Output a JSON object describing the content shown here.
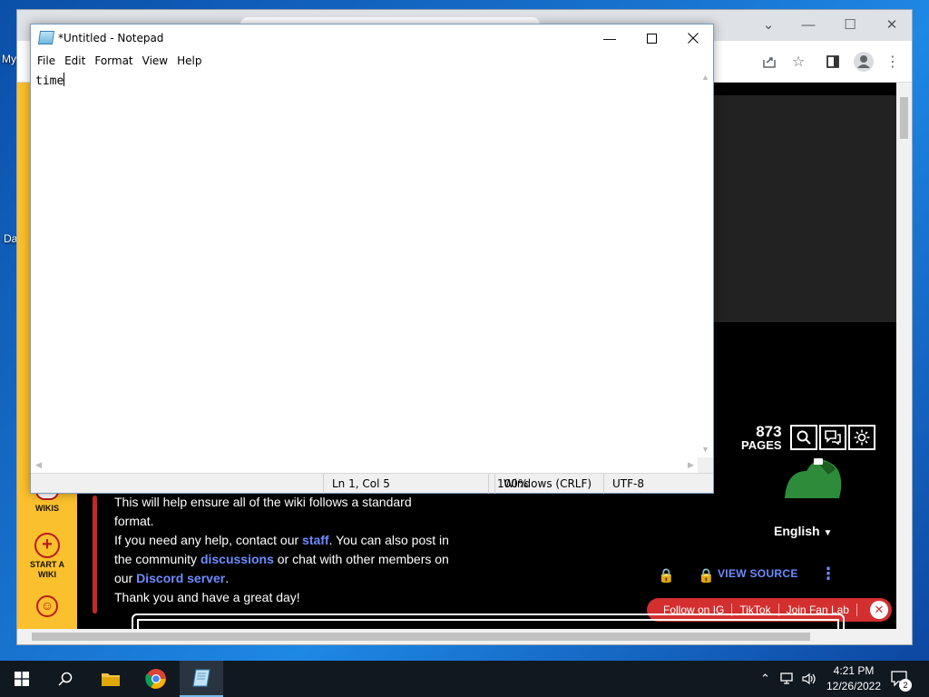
{
  "desktop": {
    "labels": [
      "My",
      "Da"
    ]
  },
  "browser": {
    "wiki": {
      "sidebar": {
        "wikis_label": "WIKIS",
        "start_wiki_label": "START A\nWIKI"
      },
      "body_lines": [
        "This will help ensure all of the wiki follows a standard",
        "format."
      ],
      "help_line_pre": "If you need any help, contact our ",
      "help_link_staff": "staff",
      "help_line_mid": ". You can also post in",
      "line_community_pre": "the community ",
      "link_discussions": "discussions",
      "line_community_post": " or chat with other members on",
      "line_our": "our ",
      "link_discord": "Discord server",
      "line_our_post": ".",
      "closing": "Thank you and have a great day!",
      "pages_count": "873",
      "pages_label": "PAGES",
      "language": "English",
      "view_source": "VIEW SOURCE",
      "promo": {
        "follow_ig": "Follow on IG",
        "tiktok": "TikTok",
        "fan_lab": "Join Fan Lab"
      }
    }
  },
  "notepad": {
    "title": "*Untitled - Notepad",
    "menu": [
      "File",
      "Edit",
      "Format",
      "View",
      "Help"
    ],
    "content": "time",
    "status": {
      "position": "Ln 1, Col 5",
      "zoom": "100%",
      "line_ending": "Windows (CRLF)",
      "encoding": "UTF-8"
    }
  },
  "taskbar": {
    "time": "4:21 PM",
    "date": "12/26/2022",
    "notifications": "2"
  },
  "colors": {
    "wiki_accent_yellow": "#fbc02d",
    "wiki_link_blue": "#6d8cff",
    "promo_red": "#d32f2f",
    "taskbar_bg": "#101820"
  }
}
